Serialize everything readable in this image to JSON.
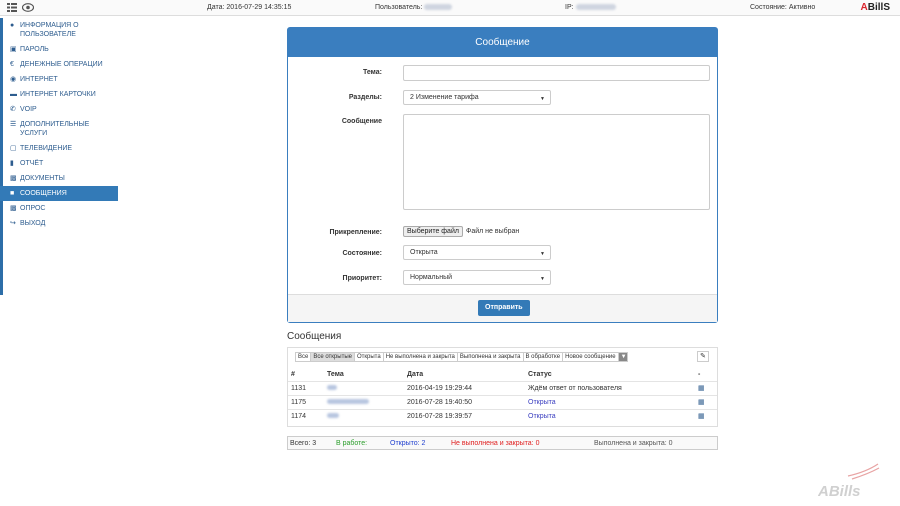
{
  "topbar": {
    "date": "Дата: 2016-07-29 14:35:15",
    "user_label": "Пользователь:",
    "ip_label": "IP:",
    "status": "Состояние: Активно",
    "logo_a": "A",
    "logo_rest": "BillS"
  },
  "sidebar": {
    "items": [
      {
        "icon": "user-icon",
        "label": "Информация о пользователе"
      },
      {
        "icon": "lock-icon",
        "label": "Пароль"
      },
      {
        "icon": "euro-icon",
        "label": "Денежные операции"
      },
      {
        "icon": "globe-icon",
        "label": "Интернет"
      },
      {
        "icon": "card-icon",
        "label": "Интернет карточки"
      },
      {
        "icon": "phone-icon",
        "label": "VoIP"
      },
      {
        "icon": "list-icon",
        "label": "Дополнительные услуги"
      },
      {
        "icon": "tv-icon",
        "label": "Телевидение"
      },
      {
        "icon": "file-icon",
        "label": "Отчёт"
      },
      {
        "icon": "briefcase-icon",
        "label": "Документы"
      },
      {
        "icon": "comment-icon",
        "label": "Сообщения"
      },
      {
        "icon": "chart-icon",
        "label": "Опрос"
      },
      {
        "icon": "logout-icon",
        "label": "Выход"
      }
    ]
  },
  "form": {
    "title": "Сообщение",
    "subject_label": "Тема:",
    "subject_value": "",
    "section_label": "Разделы:",
    "section_value": "2 Изменение тарифа",
    "message_label": "Сообщение",
    "attach_label": "Прикрепление:",
    "file_button": "Выберите файл",
    "file_status": "Файл не выбран",
    "state_label": "Состояние:",
    "state_value": "Открыта",
    "priority_label": "Приоритет:",
    "priority_value": "Нормальный",
    "submit": "Отправить"
  },
  "messages": {
    "title": "Сообщения",
    "filters": [
      "Все",
      "Все открытые",
      "Открыта",
      "Не выполнена и закрыта",
      "Выполнена и закрыта",
      "В обработке",
      "Новое сообщение"
    ],
    "columns": [
      "#",
      "Тема",
      "Дата",
      "Статус",
      "-"
    ],
    "rows": [
      {
        "id": "1131",
        "date": "2016-04-19 19:29:44",
        "status": "Ждём ответ от пользователя"
      },
      {
        "id": "1175",
        "date": "2016-07-28 19:40:50",
        "status": "Открыта"
      },
      {
        "id": "1174",
        "date": "2016-07-28 19:39:57",
        "status": "Открыта"
      }
    ]
  },
  "totals": {
    "total": "Всего: 3",
    "in_work": "В работе:",
    "open": "Открыто: 2",
    "not_done": "Не выполнена и закрыта: 0",
    "done": "Выполнена и закрыта: 0"
  },
  "colors": {
    "accent": "#337ab7",
    "in_work": "#2a9d2a",
    "open": "#1e3ecf",
    "not_done": "#e02020"
  }
}
